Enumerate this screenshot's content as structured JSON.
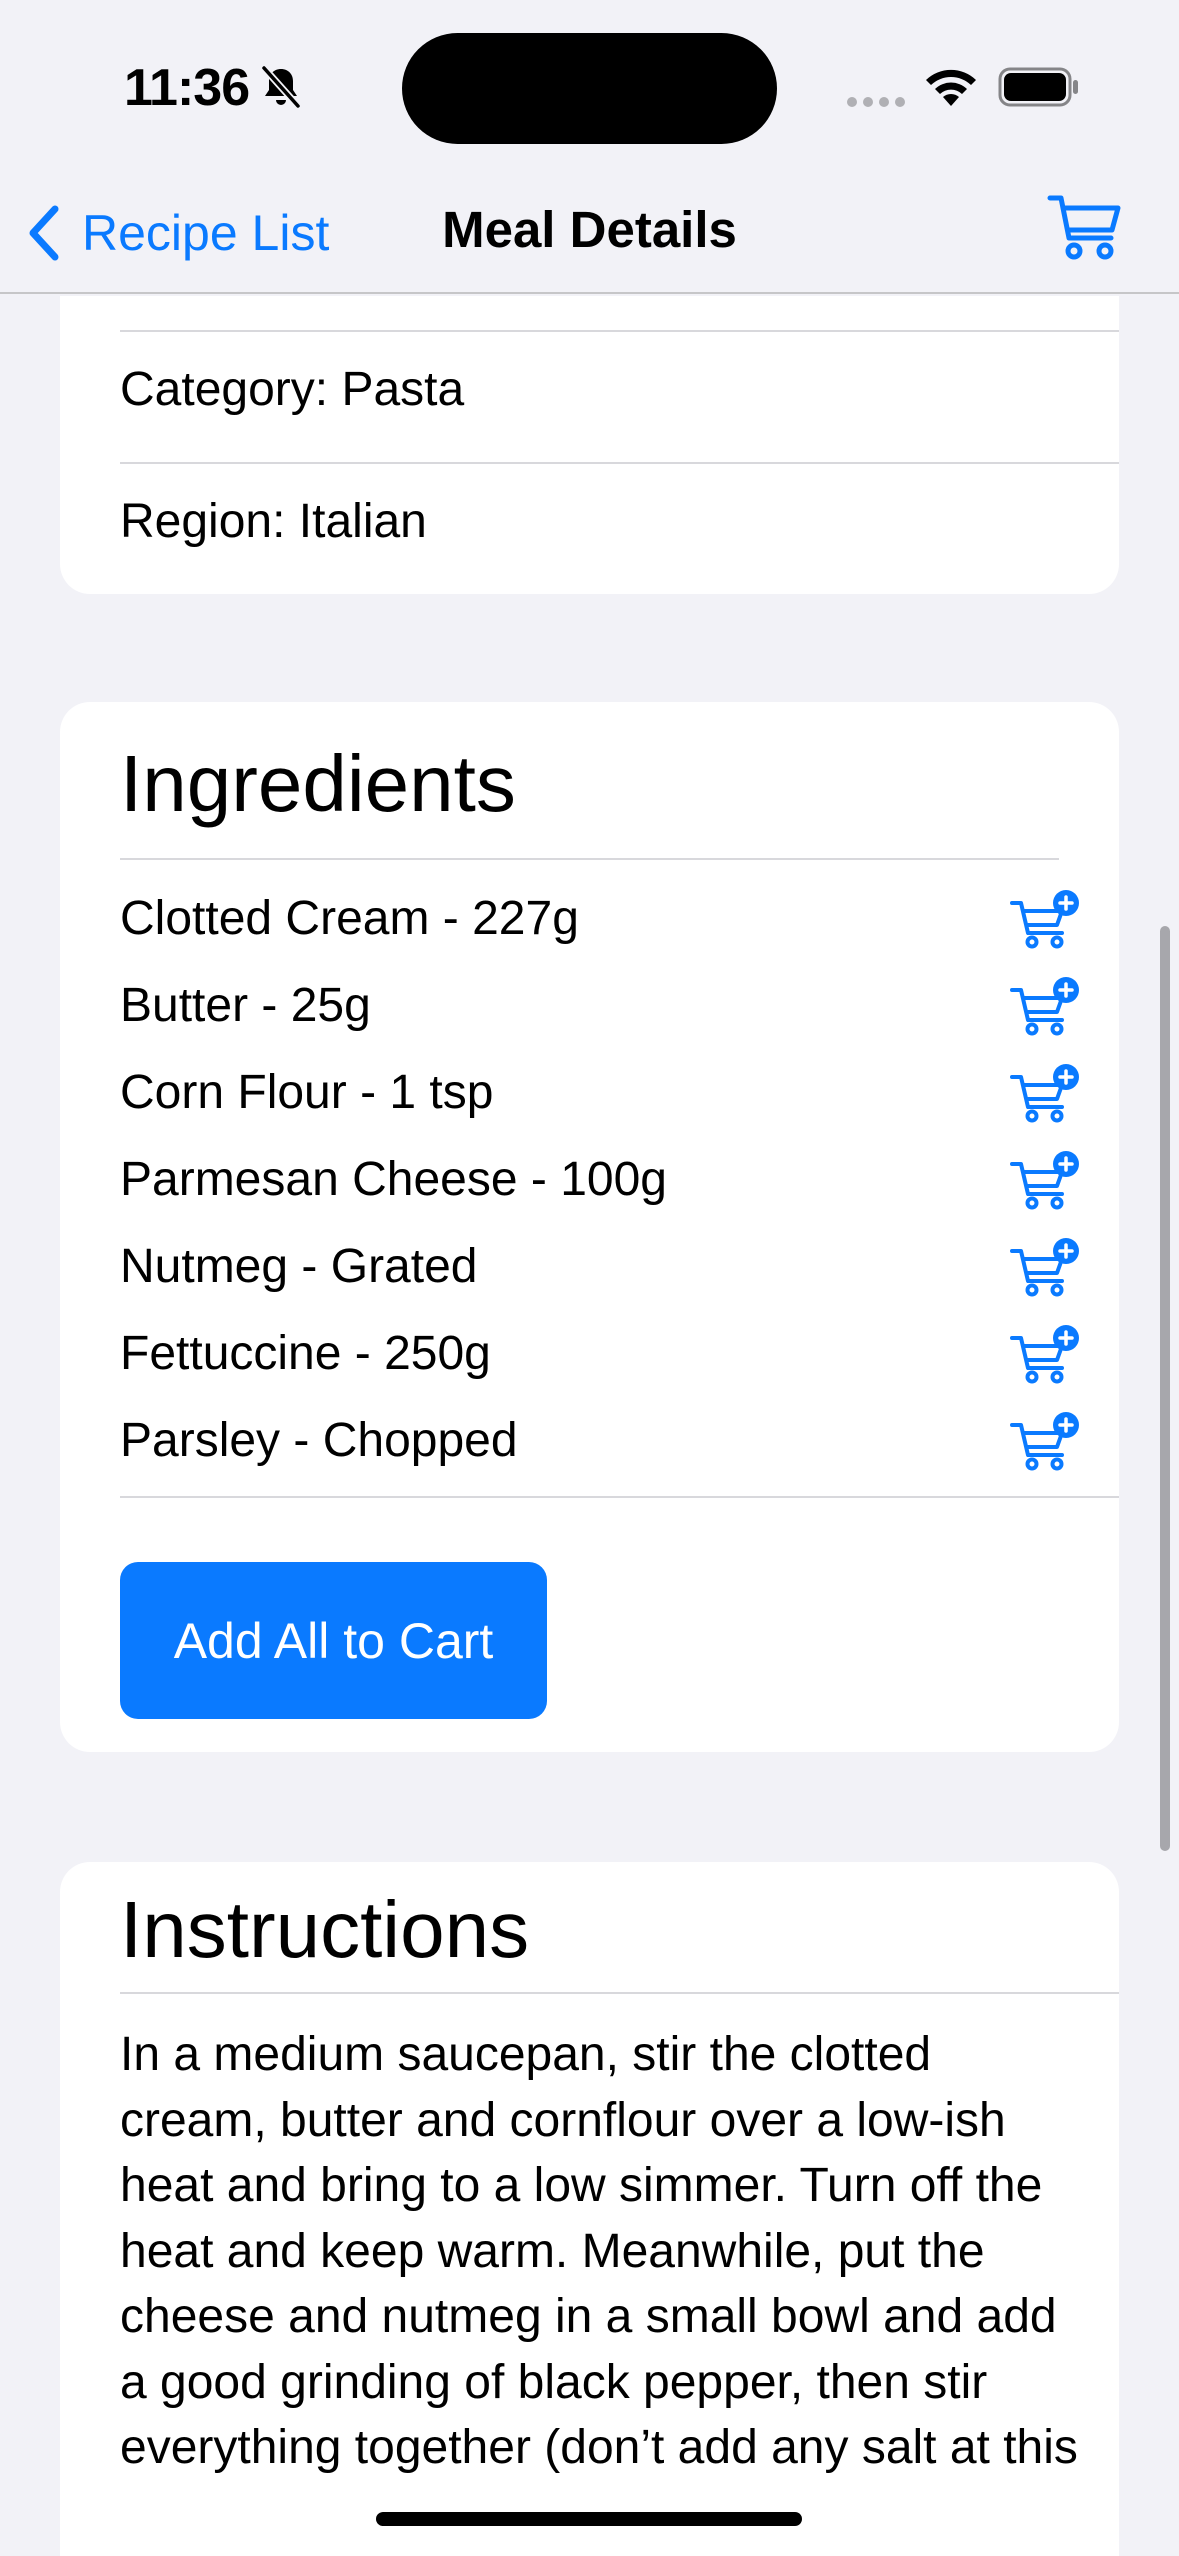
{
  "status_bar": {
    "time": "11:36",
    "icons": [
      "bell-slash-icon",
      "cellular-dots-icon",
      "wifi-icon",
      "battery-icon"
    ]
  },
  "nav": {
    "back_label": "Recipe List",
    "title": "Meal Details",
    "right_icon": "cart-icon"
  },
  "info": {
    "category": "Category: Pasta",
    "region": "Region: Italian"
  },
  "ingredients": {
    "title": "Ingredients",
    "items": [
      "Clotted Cream - 227g",
      "Butter - 25g",
      "Corn Flour - 1 tsp",
      "Parmesan Cheese - 100g",
      "Nutmeg - Grated",
      "Fettuccine - 250g",
      "Parsley - Chopped"
    ],
    "add_all_label": "Add All to Cart"
  },
  "instructions": {
    "title": "Instructions",
    "text": "In a medium saucepan, stir the clotted cream, butter and cornflour over a low-ish heat and bring to a low simmer. Turn off the heat and keep warm. Meanwhile, put the cheese and nutmeg in a small bowl and add a good grinding of black pepper, then stir everything together (don’t add any salt at this"
  },
  "colors": {
    "accent": "#0A7AFF",
    "background": "#F2F2F7",
    "card": "#FFFFFF",
    "separator": "#D8D8DC"
  }
}
